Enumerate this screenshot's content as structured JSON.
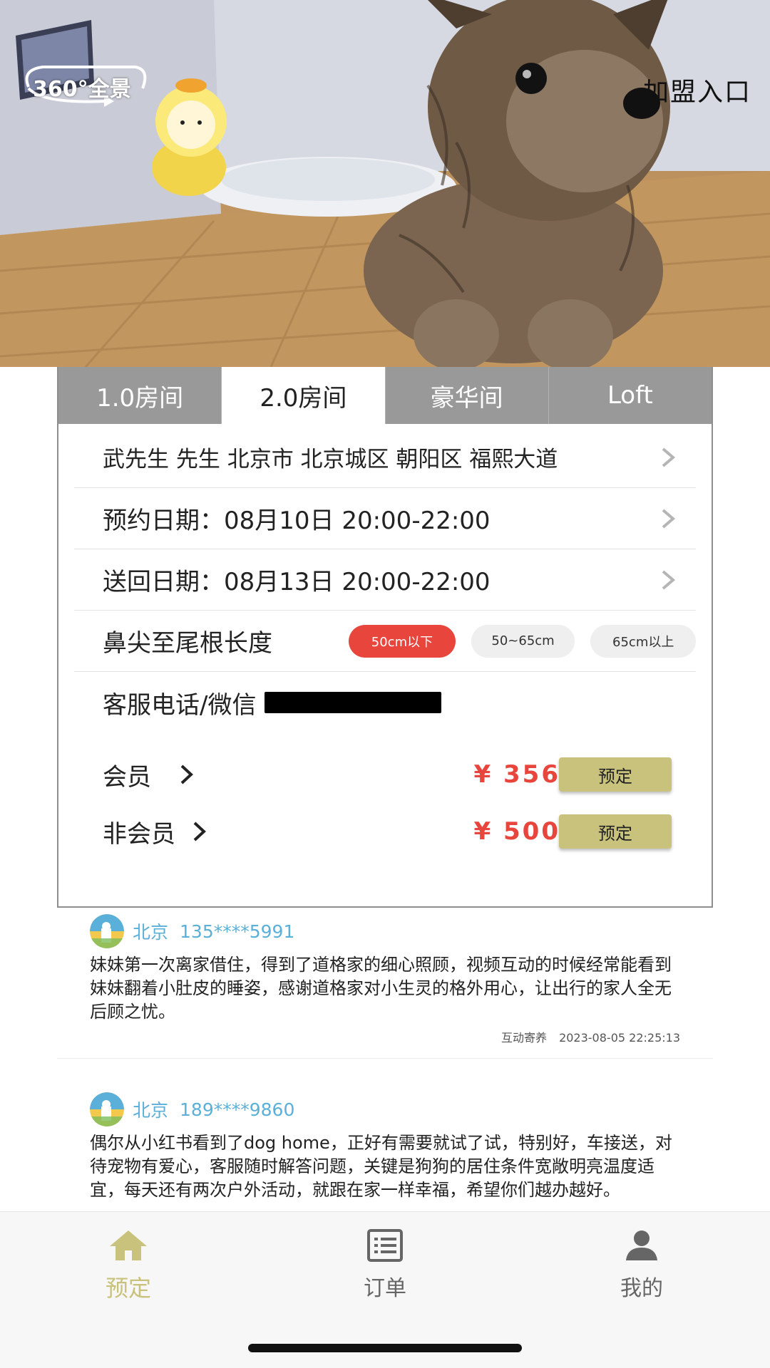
{
  "hero": {
    "pano_badge": "360°全景",
    "join_link": "加盟入口"
  },
  "tabs": [
    {
      "label": "1.0房间",
      "active": false
    },
    {
      "label": "2.0房间",
      "active": true
    },
    {
      "label": "豪华间",
      "active": false
    },
    {
      "label": "Loft",
      "active": false
    }
  ],
  "form": {
    "address": "武先生 先生 北京市 北京城区 朝阳区 福熙大道",
    "pickup": "预约日期：08月10日 20:00-22:00",
    "return": "送回日期：08月13日 20:00-22:00",
    "size_label": "鼻尖至尾根长度",
    "size_options": [
      "50cm以下",
      "50~65cm",
      "65cm以上"
    ],
    "size_selected": "50cm以下",
    "service_label": "客服电话/微信"
  },
  "pricing": {
    "member_label": "会员",
    "member_price": "¥ 356",
    "nonmember_label": "非会员",
    "nonmember_price": "¥ 500",
    "book_label": "预定"
  },
  "reviews": [
    {
      "city": "北京",
      "phone": "135****5991",
      "text": "妹妹第一次离家借住，得到了道格家的细心照顾，视频互动的时候经常能看到妹妹翻着小肚皮的睡姿，感谢道格家对小生灵的格外用心，让出行的家人全无后顾之忧。",
      "tag": "互动寄养",
      "date": "2023-08-05 22:25:13"
    },
    {
      "city": "北京",
      "phone": "189****9860",
      "text": "偶尔从小红书看到了dog home，正好有需要就试了试，特别好，车接送，对待宠物有爱心，客服随时解答问题，关键是狗狗的居住条件宽敞明亮温度适宜，每天还有两次户外活动，就跟在家一样幸福，希望你们越办越好。"
    }
  ],
  "nav": {
    "book": "预定",
    "orders": "订单",
    "mine": "我的"
  },
  "colors": {
    "accent": "#c9c27c",
    "price_red": "#e8453c",
    "tab_gray": "#999999",
    "review_blue": "#5ab0d8"
  }
}
